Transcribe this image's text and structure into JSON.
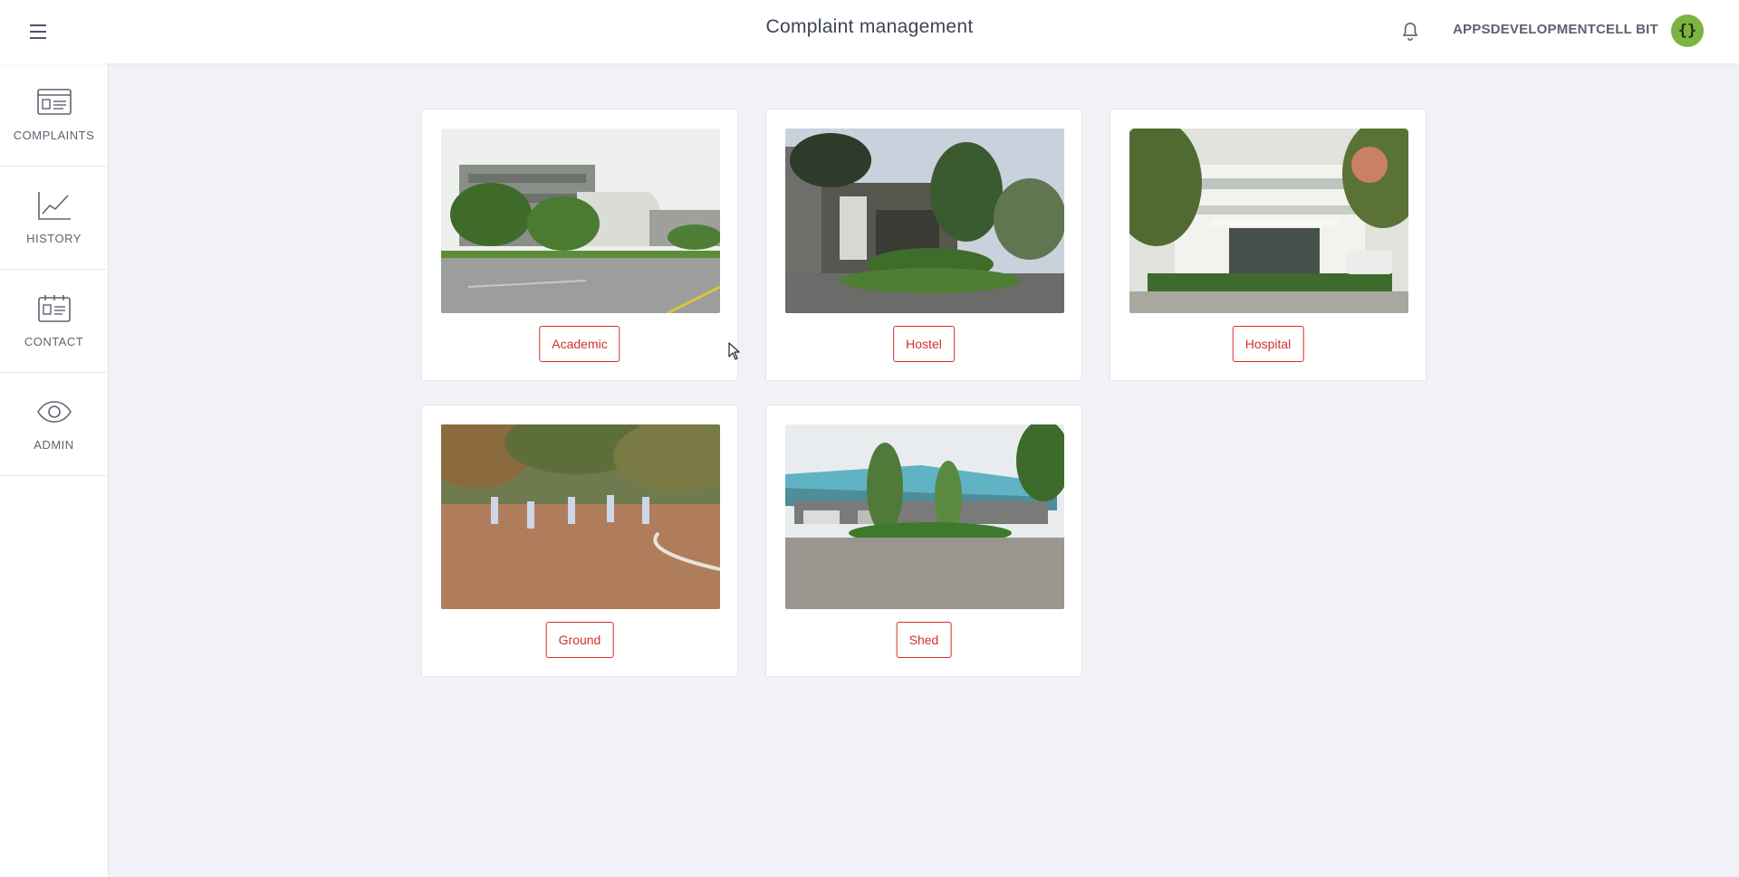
{
  "header": {
    "title": "Complaint management",
    "username": "APPSDEVELOPMENTCELL BIT",
    "avatar_text": "{}"
  },
  "sidebar": {
    "items": [
      {
        "label": "COMPLAINTS",
        "icon": "complaints-list-icon"
      },
      {
        "label": "HISTORY",
        "icon": "line-chart-icon"
      },
      {
        "label": "CONTACT",
        "icon": "contact-card-icon"
      },
      {
        "label": "ADMIN",
        "icon": "eye-icon"
      }
    ]
  },
  "categories": [
    {
      "label": "Academic",
      "photo": "academic-building-photo"
    },
    {
      "label": "Hostel",
      "photo": "hostel-building-photo"
    },
    {
      "label": "Hospital",
      "photo": "hospital-building-photo"
    },
    {
      "label": "Ground",
      "photo": "sports-ground-photo"
    },
    {
      "label": "Shed",
      "photo": "parking-shed-photo"
    }
  ],
  "colors": {
    "accent": "#d32f2f",
    "avatar": "#7cb342",
    "background": "#f1f2f8"
  }
}
